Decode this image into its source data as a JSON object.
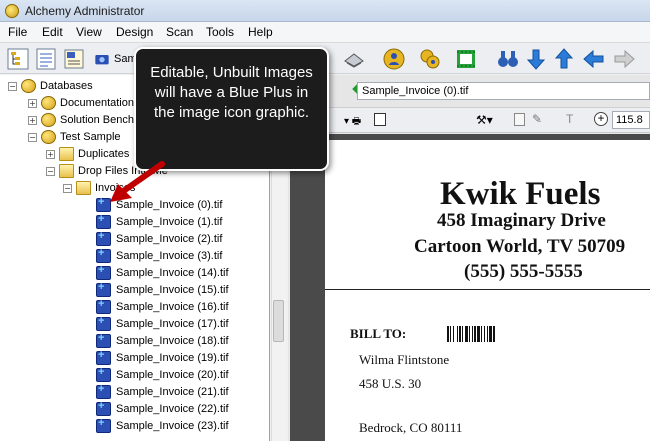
{
  "window": {
    "title": "Alchemy Administrator"
  },
  "menu": [
    "File",
    "Edit",
    "View",
    "Design",
    "Scan",
    "Tools",
    "Help"
  ],
  "toolbar": {
    "partial_label": "Sam"
  },
  "tree": {
    "nodes": [
      {
        "label": "Databases",
        "level": 0,
        "expander": "−",
        "icon": "database"
      },
      {
        "label": "Documentation",
        "level": 1,
        "expander": "+",
        "icon": "database"
      },
      {
        "label": "Solution Bench",
        "level": 1,
        "expander": "+",
        "icon": "database"
      },
      {
        "label": "Test Sample",
        "level": 1,
        "expander": "−",
        "icon": "database"
      },
      {
        "label": "Duplicates",
        "level": 2,
        "expander": "+",
        "icon": "folder"
      },
      {
        "label": "Drop Files Into Me",
        "level": 2,
        "expander": "−",
        "icon": "folder"
      },
      {
        "label": "Invoices",
        "level": 3,
        "expander": "−",
        "icon": "folder"
      },
      {
        "label": "Sample_Invoice (0).tif",
        "level": 4,
        "expander": "",
        "icon": "image"
      },
      {
        "label": "Sample_Invoice (1).tif",
        "level": 4,
        "expander": "",
        "icon": "image"
      },
      {
        "label": "Sample_Invoice (2).tif",
        "level": 4,
        "expander": "",
        "icon": "image"
      },
      {
        "label": "Sample_Invoice (3).tif",
        "level": 4,
        "expander": "",
        "icon": "image"
      },
      {
        "label": "Sample_Invoice (14).tif",
        "level": 4,
        "expander": "",
        "icon": "image"
      },
      {
        "label": "Sample_Invoice (15).tif",
        "level": 4,
        "expander": "",
        "icon": "image"
      },
      {
        "label": "Sample_Invoice (16).tif",
        "level": 4,
        "expander": "",
        "icon": "image"
      },
      {
        "label": "Sample_Invoice (17).tif",
        "level": 4,
        "expander": "",
        "icon": "image"
      },
      {
        "label": "Sample_Invoice (18).tif",
        "level": 4,
        "expander": "",
        "icon": "image"
      },
      {
        "label": "Sample_Invoice (19).tif",
        "level": 4,
        "expander": "",
        "icon": "image"
      },
      {
        "label": "Sample_Invoice (20).tif",
        "level": 4,
        "expander": "",
        "icon": "image"
      },
      {
        "label": "Sample_Invoice (21).tif",
        "level": 4,
        "expander": "",
        "icon": "image"
      },
      {
        "label": "Sample_Invoice (22).tif",
        "level": 4,
        "expander": "",
        "icon": "image"
      },
      {
        "label": "Sample_Invoice (23).tif",
        "level": 4,
        "expander": "",
        "icon": "image"
      }
    ]
  },
  "viewer": {
    "path": "Sample_Invoice (0).tif",
    "zoom": "115.8"
  },
  "document": {
    "company": "Kwik Fuels",
    "address1": "458 Imaginary Drive",
    "address2": "Cartoon World, TV 50709",
    "phone": "(555) 555-5555",
    "bill_to_label": "BILL TO:",
    "customer_name": "Wilma Flintstone",
    "customer_street": "458 U.S. 30",
    "customer_city": "Bedrock, CO 80111"
  },
  "callout": {
    "text": "Editable, Unbuilt Images will have a Blue Plus in the image icon graphic."
  },
  "colors": {
    "callout_bg": "#1c1c1c",
    "arrow": "#c00000",
    "tree_bg": "#ffffff",
    "doc_bg": "#ffffff"
  }
}
